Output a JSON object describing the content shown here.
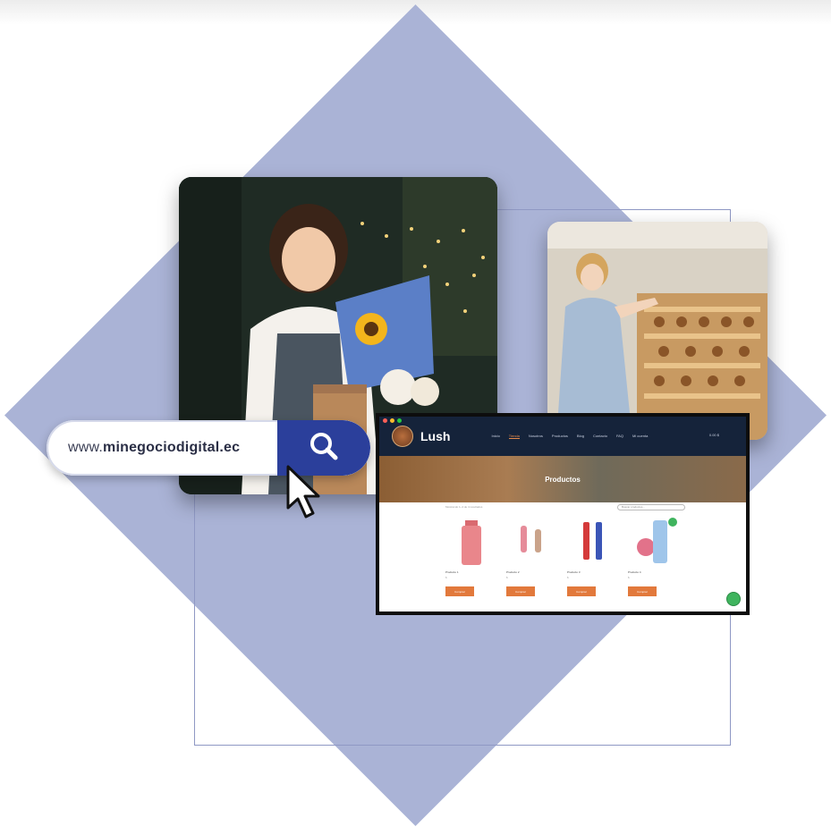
{
  "search_bar": {
    "url_prefix": "www.",
    "url_domain": "minegociodigital.ec",
    "search_icon": "search-icon"
  },
  "website": {
    "brand": "Lush",
    "nav_items": [
      "Inicio",
      "Tienda",
      "Nosotros",
      "Productos",
      "Blog",
      "Contacto",
      "FAQ",
      "Mi cuenta"
    ],
    "cart_label": "0.00 $",
    "hero_title": "Productos",
    "shop_meta": "Mostrando 1–4 de 4 resultados",
    "search_placeholder": "Buscar productos…",
    "products": [
      {
        "name": "Producto 1",
        "price": "$",
        "button": "Comprar"
      },
      {
        "name": "Producto 2",
        "price": "$",
        "button": "Comprar"
      },
      {
        "name": "Producto 3",
        "price": "$",
        "button": "Comprar"
      },
      {
        "name": "Producto 4",
        "price": "$",
        "button": "Comprar"
      }
    ],
    "chat_icon": "whatsapp-icon"
  },
  "colors": {
    "diamond": "#aab3d6",
    "search_button": "#2b3f9b",
    "nav_bg": "#15233a",
    "accent": "#e2793c"
  }
}
